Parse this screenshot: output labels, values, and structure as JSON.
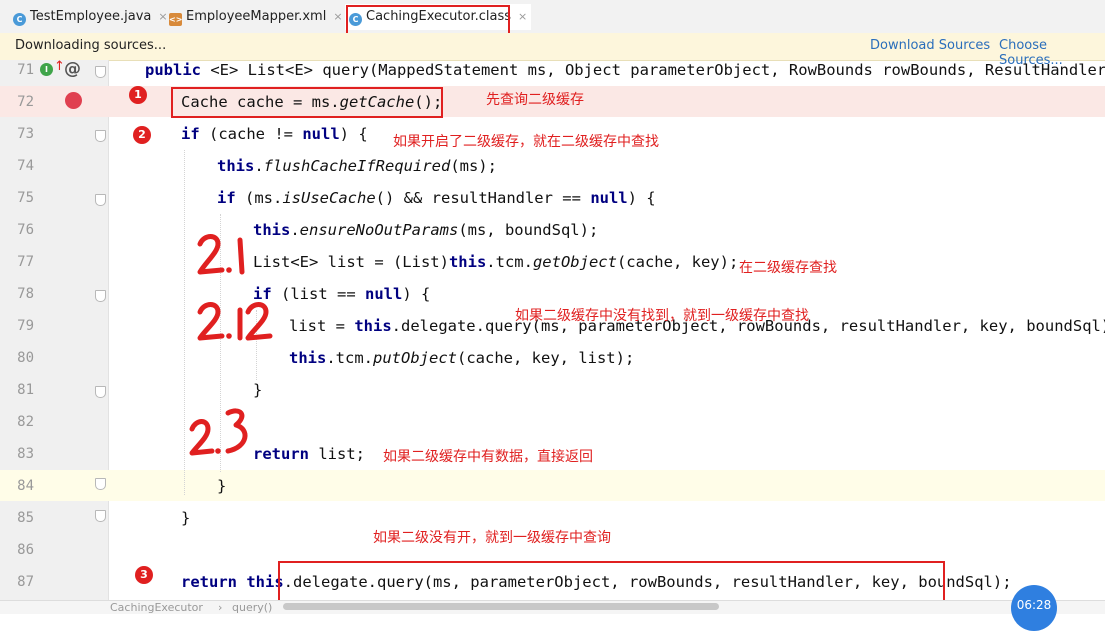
{
  "tabs": [
    {
      "label": "TestEmployee.java",
      "icon": "java-class-icon",
      "icon_letter": "C",
      "active": false
    },
    {
      "label": "EmployeeMapper.xml",
      "icon": "xml-file-icon",
      "icon_letter": "<>",
      "active": false
    },
    {
      "label": "CachingExecutor.class",
      "icon": "class-file-icon",
      "icon_letter": "C",
      "active": true
    }
  ],
  "tab_close": "×",
  "notification": {
    "text": "Downloading sources...",
    "download_label": "Download Sources",
    "choose_label": "Choose Sources..."
  },
  "gutter_markers": {
    "implements": "I",
    "annotation": "@"
  },
  "code_lines": [
    {
      "line": "71",
      "text": "public <E> List<E> query(MappedStatement ms, Object parameterObject, RowBounds rowBounds, ResultHandler res"
    },
    {
      "line": "72",
      "text": "Cache cache = ms.getCache();"
    },
    {
      "line": "73",
      "text": "if (cache != null) {"
    },
    {
      "line": "74",
      "text": "this.flushCacheIfRequired(ms);"
    },
    {
      "line": "75",
      "text": "if (ms.isUseCache() && resultHandler == null) {"
    },
    {
      "line": "76",
      "text": "this.ensureNoOutParams(ms, boundSql);"
    },
    {
      "line": "77",
      "text": "List<E> list = (List)this.tcm.getObject(cache, key);"
    },
    {
      "line": "78",
      "text": "if (list == null) {"
    },
    {
      "line": "79",
      "text": "list = this.delegate.query(ms, parameterObject, rowBounds, resultHandler, key, boundSql);"
    },
    {
      "line": "80",
      "text": "this.tcm.putObject(cache, key, list);"
    },
    {
      "line": "81",
      "text": "}"
    },
    {
      "line": "82",
      "text": ""
    },
    {
      "line": "83",
      "text": "return list;"
    },
    {
      "line": "84",
      "text": "}"
    },
    {
      "line": "85",
      "text": "}"
    },
    {
      "line": "86",
      "text": ""
    },
    {
      "line": "87",
      "text": "return this.delegate.query(ms, parameterObject, rowBounds, resultHandler, key, boundSql);"
    }
  ],
  "annotations": {
    "a1": "先查询二级缓存",
    "a2": "如果开启了二级缓存，就在二级缓存中查找",
    "a3": "在二级缓存查找",
    "a4": "如果二级缓存中没有找到，就到一级缓存中查找",
    "a5": "如果二级缓存中有数据，直接返回",
    "a6": "如果二级没有开，就到一级缓存中查询"
  },
  "step_markers": {
    "s1": "1",
    "s2": "2",
    "s3": "3"
  },
  "handwritten": {
    "h21": "2.1",
    "h22": "2.2",
    "h23": "2.3"
  },
  "breadcrumb": [
    "CachingExecutor",
    "query()"
  ],
  "clock": "06:28",
  "colors": {
    "annotation_red": "#e02020",
    "keyword_navy": "#000080",
    "breakpoint": "#e04050",
    "link": "#2a6ebb"
  }
}
